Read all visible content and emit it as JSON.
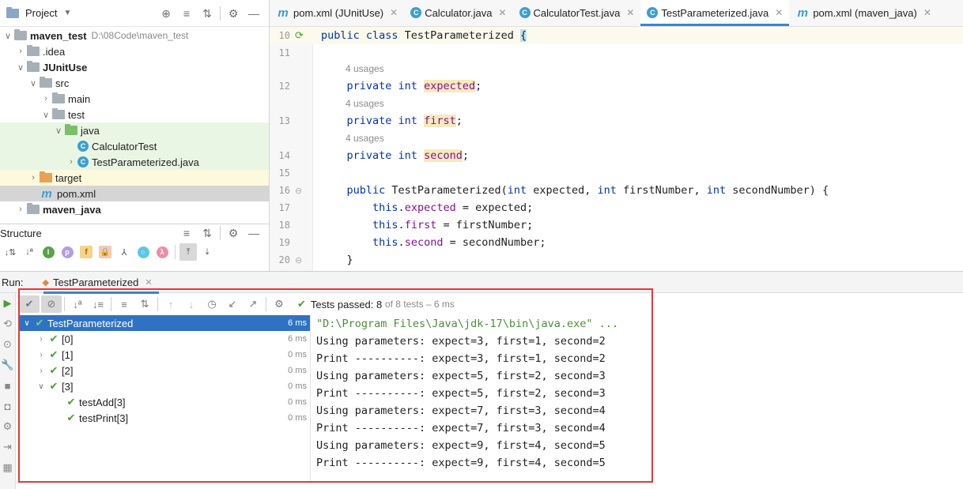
{
  "project_panel": {
    "title": "Project",
    "items": [
      {
        "label": "maven_test",
        "path": "D:\\08Code\\maven_test"
      },
      {
        "label": ".idea"
      },
      {
        "label": "JUnitUse"
      },
      {
        "label": "src"
      },
      {
        "label": "main"
      },
      {
        "label": "test"
      },
      {
        "label": "java"
      },
      {
        "label": "CalculatorTest"
      },
      {
        "label": "TestParameterized.java"
      },
      {
        "label": "target"
      },
      {
        "label": "pom.xml"
      },
      {
        "label": "maven_java"
      }
    ]
  },
  "structure_panel": {
    "title": "Structure",
    "icon_letters": [
      "I",
      "p",
      "f",
      "λ"
    ]
  },
  "editor": {
    "tabs": [
      {
        "label": "pom.xml (JUnitUse)",
        "icon": "m-icon"
      },
      {
        "label": "Calculator.java",
        "icon": "class-icon"
      },
      {
        "label": "CalculatorTest.java",
        "icon": "class-icon"
      },
      {
        "label": "TestParameterized.java",
        "icon": "class-icon",
        "active": true
      },
      {
        "label": "pom.xml (maven_java)",
        "icon": "m-icon"
      }
    ],
    "usages_hint": "4 usages",
    "lines": [
      {
        "num": "10",
        "text": "public class TestParameterized {"
      },
      {
        "num": "11",
        "text": ""
      },
      {
        "num": "12",
        "text": "    private int expected;"
      },
      {
        "num": "13",
        "text": "    private int first;"
      },
      {
        "num": "14",
        "text": "    private int second;"
      },
      {
        "num": "15",
        "text": ""
      },
      {
        "num": "16",
        "text": "    public TestParameterized(int expected, int firstNumber, int secondNumber) {"
      },
      {
        "num": "17",
        "text": "        this.expected = expected;"
      },
      {
        "num": "18",
        "text": "        this.first = firstNumber;"
      },
      {
        "num": "19",
        "text": "        this.second = secondNumber;"
      },
      {
        "num": "20",
        "text": "    }"
      }
    ]
  },
  "run_panel": {
    "label": "Run:",
    "tab": "TestParameterized",
    "status": {
      "passed": "Tests passed:",
      "count": "8",
      "rest": "of 8 tests – 6 ms"
    },
    "tests": [
      {
        "label": "TestParameterized",
        "dur": "6 ms"
      },
      {
        "label": "[0]",
        "dur": "6 ms"
      },
      {
        "label": "[1]",
        "dur": "0 ms"
      },
      {
        "label": "[2]",
        "dur": "0 ms"
      },
      {
        "label": "[3]",
        "dur": "0 ms"
      },
      {
        "label": "testAdd[3]",
        "dur": "0 ms"
      },
      {
        "label": "testPrint[3]",
        "dur": "0 ms"
      }
    ],
    "console": [
      "\"D:\\Program Files\\Java\\jdk-17\\bin\\java.exe\" ...",
      "Using parameters: expect=3, first=1, second=2",
      "Print ----------: expect=3, first=1, second=2",
      "Using parameters: expect=5, first=2, second=3",
      "Print ----------: expect=5, first=2, second=3",
      "Using parameters: expect=7, first=3, second=4",
      "Print ----------: expect=7, first=3, second=4",
      "Using parameters: expect=9, first=4, second=5",
      "Print ----------: expect=9, first=4, second=5"
    ]
  },
  "colors": {
    "accent": "#2f72c4",
    "pass": "#4b9e37",
    "highlight_box": "#e2393a",
    "keyword": "#0033b3",
    "field": "#871094"
  }
}
